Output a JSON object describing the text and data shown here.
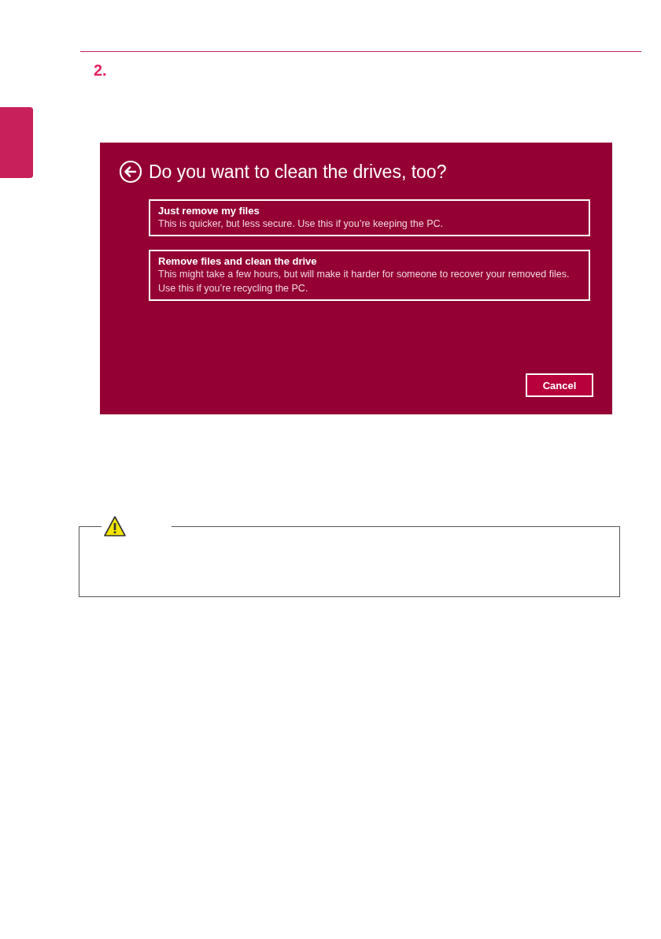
{
  "step": {
    "number": "2."
  },
  "dialog": {
    "title": "Do you want to clean the drives, too?",
    "options": [
      {
        "title": "Just remove my files",
        "description": "This is quicker, but less secure. Use this if you’re keeping the PC."
      },
      {
        "title": "Remove files and clean the drive",
        "description": "This might take a few hours, but will make it harder for someone to recover your removed files. Use this if you’re recycling the PC."
      }
    ],
    "cancel_button": "Cancel"
  }
}
